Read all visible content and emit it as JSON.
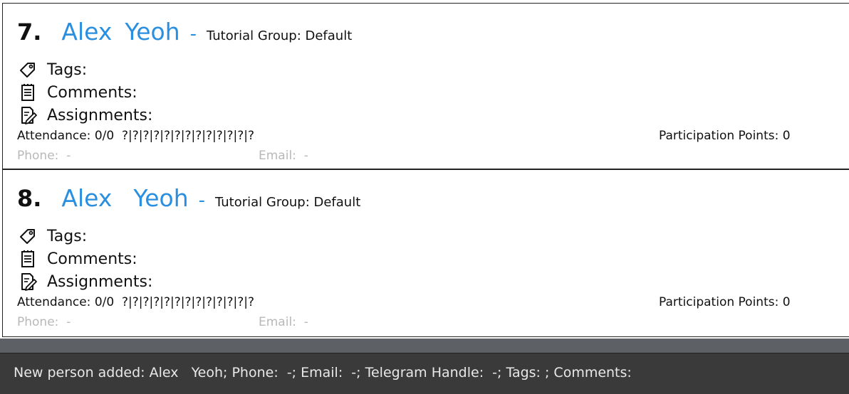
{
  "persons": [
    {
      "index": "7.",
      "first_name": "Alex",
      "last_name": "Yeoh",
      "dash": "-",
      "tutorial_group": "Tutorial Group: Default",
      "tags_label": "Tags:",
      "comments_label": "Comments:",
      "assignments_label": "Assignments:",
      "attendance": "Attendance: 0/0  ?|?|?|?|?|?|?|?|?|?|?|?|?",
      "participation": "Participation Points: 0",
      "phone": "Phone:  -",
      "email": "Email:  -"
    },
    {
      "index": "8.",
      "first_name": "Alex",
      "last_name": "Yeoh",
      "dash": "-",
      "tutorial_group": "Tutorial Group: Default",
      "tags_label": "Tags:",
      "comments_label": "Comments:",
      "assignments_label": "Assignments:",
      "attendance": "Attendance: 0/0  ?|?|?|?|?|?|?|?|?|?|?|?|?",
      "participation": "Participation Points: 0",
      "phone": "Phone:  -",
      "email": "Email:  -"
    }
  ],
  "result_display": {
    "text": "New person added: Alex   Yeoh; Phone:  -; Email:  -; Telegram Handle:  -; Tags: ; Comments:"
  },
  "icons": [
    "tag-icon",
    "notepad-icon",
    "edit-document-icon"
  ],
  "colors": {
    "name": "#2b8fe0",
    "muted": "#b8b8b8",
    "result_bg": "#3a3a3a",
    "divider": "#5d6166"
  }
}
